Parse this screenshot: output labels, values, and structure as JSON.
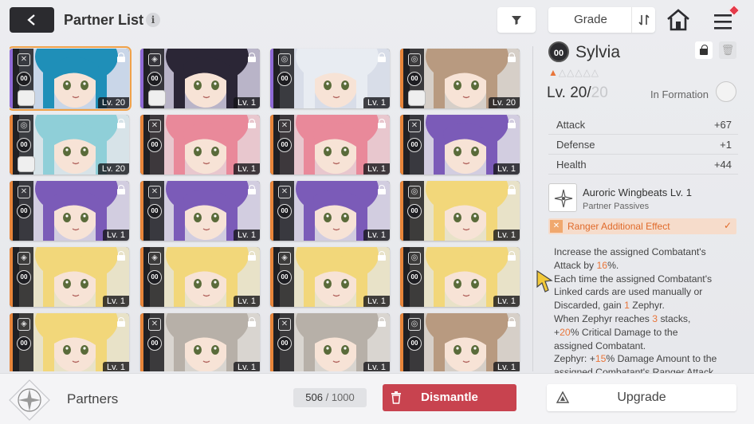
{
  "header": {
    "title": "Partner List",
    "info_glyph": "i",
    "sort_label": "Grade"
  },
  "cards": [
    {
      "level": "Lv. 20",
      "role": "sword",
      "stripe": "#8f6ad6",
      "hair": "#1f8fb8",
      "bg": "#c9d6e8",
      "selected": true,
      "chibi": true
    },
    {
      "level": "Lv. 1",
      "role": "shield",
      "stripe": "#8f6ad6",
      "hair": "#2b2636",
      "bg": "#b9b4c8",
      "selected": false,
      "chibi": true
    },
    {
      "level": "Lv. 1",
      "role": "orb",
      "stripe": "#8f6ad6",
      "hair": "#e8ecf2",
      "bg": "#d8dde8",
      "selected": false,
      "chibi": false
    },
    {
      "level": "Lv. 20",
      "role": "orb",
      "stripe": "#e8853a",
      "hair": "#b89a80",
      "bg": "#d6cfc8",
      "selected": false,
      "chibi": true
    },
    {
      "level": "Lv. 20",
      "role": "orb",
      "stripe": "#e8853a",
      "hair": "#8fcfd8",
      "bg": "#d7e3e8",
      "selected": false,
      "chibi": true
    },
    {
      "level": "Lv. 1",
      "role": "sword",
      "stripe": "#e8853a",
      "hair": "#e9899a",
      "bg": "#e8c7ce",
      "selected": false,
      "chibi": false
    },
    {
      "level": "Lv. 1",
      "role": "sword",
      "stripe": "#e8853a",
      "hair": "#e9899a",
      "bg": "#e8c7ce",
      "selected": false,
      "chibi": false
    },
    {
      "level": "Lv. 1",
      "role": "sword",
      "stripe": "#e8853a",
      "hair": "#7b5bb8",
      "bg": "#d2cde0",
      "selected": false,
      "chibi": false
    },
    {
      "level": "Lv. 1",
      "role": "sword",
      "stripe": "#e8853a",
      "hair": "#7b5bb8",
      "bg": "#d2cde0",
      "selected": false,
      "chibi": false
    },
    {
      "level": "Lv. 1",
      "role": "sword",
      "stripe": "#e8853a",
      "hair": "#7b5bb8",
      "bg": "#d2cde0",
      "selected": false,
      "chibi": false
    },
    {
      "level": "Lv. 1",
      "role": "sword",
      "stripe": "#e8853a",
      "hair": "#7b5bb8",
      "bg": "#d2cde0",
      "selected": false,
      "chibi": false
    },
    {
      "level": "Lv. 1",
      "role": "orb",
      "stripe": "#e8853a",
      "hair": "#f2d77a",
      "bg": "#e8e2c8",
      "selected": false,
      "chibi": false
    },
    {
      "level": "Lv. 1",
      "role": "shield",
      "stripe": "#e8853a",
      "hair": "#f2d77a",
      "bg": "#e8e2c8",
      "selected": false,
      "chibi": false
    },
    {
      "level": "Lv. 1",
      "role": "shield",
      "stripe": "#e8853a",
      "hair": "#f2d77a",
      "bg": "#e8e2c8",
      "selected": false,
      "chibi": false
    },
    {
      "level": "Lv. 1",
      "role": "shield",
      "stripe": "#e8853a",
      "hair": "#f2d77a",
      "bg": "#e8e2c8",
      "selected": false,
      "chibi": false
    },
    {
      "level": "Lv. 1",
      "role": "orb",
      "stripe": "#e8853a",
      "hair": "#f2d77a",
      "bg": "#e8e2c8",
      "selected": false,
      "chibi": false
    },
    {
      "level": "Lv. 1",
      "role": "shield",
      "stripe": "#e8853a",
      "hair": "#f2d77a",
      "bg": "#e8e2c8",
      "selected": false,
      "chibi": false
    },
    {
      "level": "Lv. 1",
      "role": "sword",
      "stripe": "#e8853a",
      "hair": "#b7b0a8",
      "bg": "#d9d5d0",
      "selected": false,
      "chibi": false
    },
    {
      "level": "Lv. 1",
      "role": "sword",
      "stripe": "#e8853a",
      "hair": "#b7b0a8",
      "bg": "#d9d5d0",
      "selected": false,
      "chibi": false
    },
    {
      "level": "Lv. 1",
      "role": "orb",
      "stripe": "#e8853a",
      "hair": "#b89a80",
      "bg": "#d6cfc8",
      "selected": false,
      "chibi": false
    }
  ],
  "card_grade": "00",
  "panel": {
    "grade": "00",
    "name": "Sylvia",
    "trash_glyph": "🗑",
    "stars": {
      "on": "▲",
      "off": "△△△△△"
    },
    "level_current": "Lv. 20/",
    "level_max": "20",
    "formation": "In Formation",
    "stats": [
      {
        "label": "Attack",
        "value": "+67"
      },
      {
        "label": "Defense",
        "value": "+1"
      },
      {
        "label": "Health",
        "value": "+44"
      }
    ],
    "passive_name": "Auroric Wingbeats Lv. 1",
    "passive_sub": "Partner Passives",
    "effect_label": "Ranger Additional Effect",
    "effect_check": "✓",
    "desc": {
      "l1": "Increase the assigned Combatant's",
      "l2a": "Attack by ",
      "l2b": "16",
      "l2c": "%.",
      "l3": "Each time the assigned Combatant's",
      "l4": "Linked cards are used manually or",
      "l5a": "Discarded, gain ",
      "l5b": "1",
      "l5c": " Zephyr.",
      "l6a": "When Zephyr reaches ",
      "l6b": "3",
      "l6c": " stacks,",
      "l7a": "+",
      "l7b": "20",
      "l7c": "% Critical Damage to the",
      "l8": "assigned Combatant.",
      "l9a": "Zephyr: +",
      "l9b": "15",
      "l9c": "% Damage Amount to the",
      "l10": "assigned Combatant's Ranger Attack"
    }
  },
  "footer": {
    "label": "Partners",
    "count_current": "506",
    "count_sep": " / ",
    "count_max": "1000",
    "dismantle_label": "Dismantle",
    "upgrade_label": "Upgrade"
  },
  "colors": {
    "accent": "#e8753a",
    "dismantle": "#c8434f",
    "selected_outline": "#f0a24a"
  }
}
